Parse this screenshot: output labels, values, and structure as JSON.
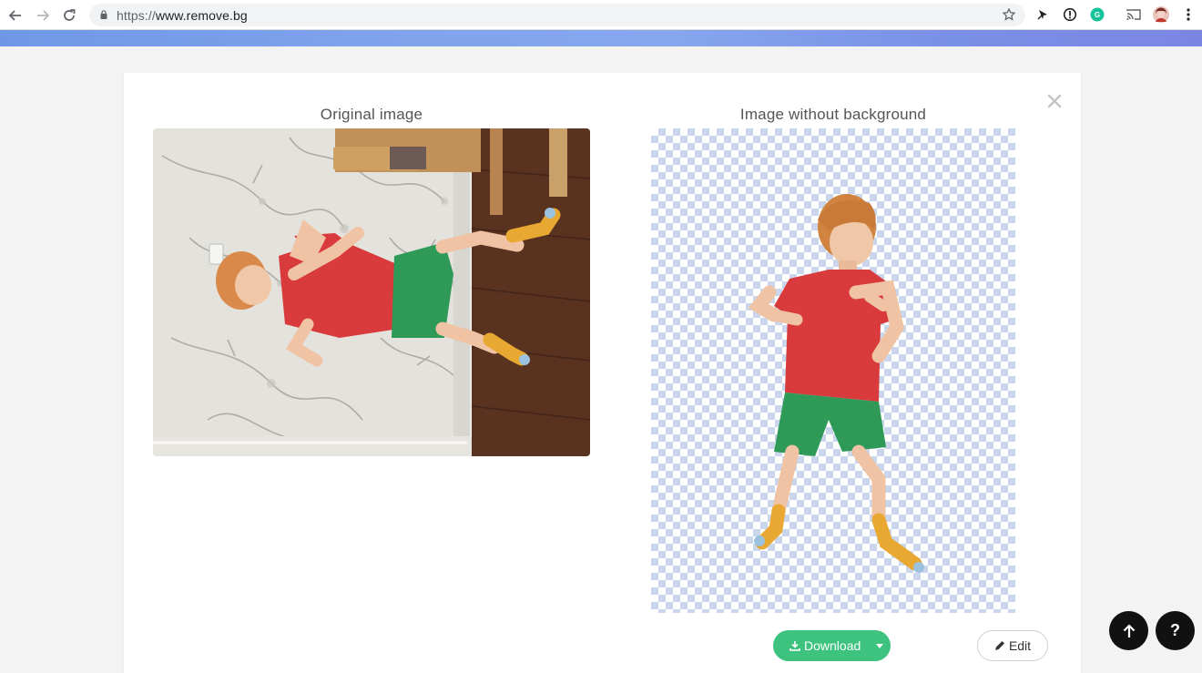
{
  "browser": {
    "url_prefix": "https://",
    "url_host": "www.remove.bg",
    "icons": [
      "back-arrow-icon",
      "forward-arrow-icon",
      "reload-icon",
      "lock-icon",
      "star-icon",
      "pin-extension-icon",
      "info-extension-icon",
      "grammarly-extension-icon",
      "cast-icon",
      "profile-avatar",
      "menu-kebab-icon"
    ]
  },
  "modal": {
    "left_title": "Original image",
    "right_title": "Image without background",
    "close_icon": "close-icon"
  },
  "actions": {
    "download_label": "Download",
    "edit_label": "Edit"
  },
  "floating": {
    "scroll_top_icon": "arrow-up-icon",
    "help_label": "?"
  },
  "colors": {
    "accent_green": "#3ec37f",
    "stripe_blue": "#7fa2ec",
    "checker_blue": "#c9d6ec"
  }
}
